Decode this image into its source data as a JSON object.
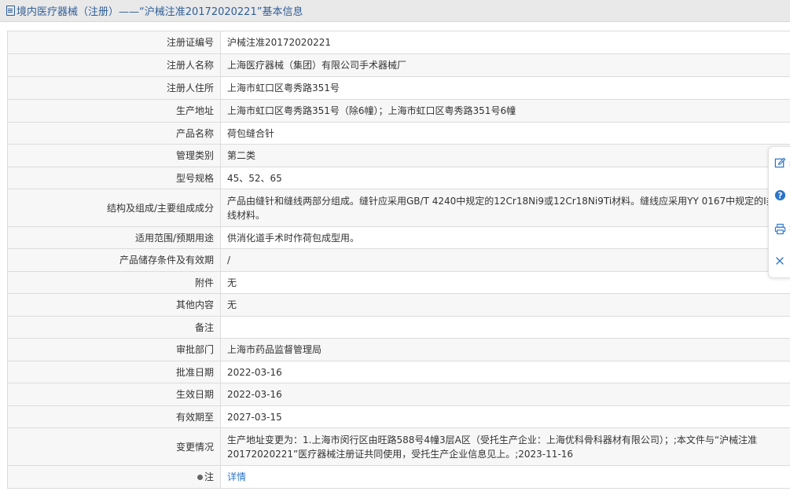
{
  "header": {
    "title": "境内医疗器械（注册）——“沪械注准20172020221”基本信息"
  },
  "rows": [
    {
      "label": "注册证编号",
      "value": "沪械注准20172020221"
    },
    {
      "label": "注册人名称",
      "value": "上海医疗器械（集团）有限公司手术器械厂"
    },
    {
      "label": "注册人住所",
      "value": "上海市虹口区粤秀路351号"
    },
    {
      "label": "生产地址",
      "value": "上海市虹口区粤秀路351号（除6幢）；上海市虹口区粤秀路351号6幢"
    },
    {
      "label": "产品名称",
      "value": "荷包缝合针"
    },
    {
      "label": "管理类别",
      "value": "第二类"
    },
    {
      "label": "型号规格",
      "value": "45、52、65"
    },
    {
      "label": "结构及组成/主要组成成分",
      "value": "产品由缝针和缝线两部分组成。缝针应采用GB/T 4240中规定的12Cr18Ni9或12Cr18Ni9Ti材料。缝线应采用YY 0167中规定的I类缝线材料。"
    },
    {
      "label": "适用范围/预期用途",
      "value": "供消化道手术时作荷包成型用。"
    },
    {
      "label": "产品储存条件及有效期",
      "value": "/"
    },
    {
      "label": "附件",
      "value": "无"
    },
    {
      "label": "其他内容",
      "value": "无"
    },
    {
      "label": "备注",
      "value": ""
    },
    {
      "label": "审批部门",
      "value": "上海市药品监督管理局"
    },
    {
      "label": "批准日期",
      "value": "2022-03-16"
    },
    {
      "label": "生效日期",
      "value": "2022-03-16"
    },
    {
      "label": "有效期至",
      "value": "2027-03-15"
    },
    {
      "label": "变更情况",
      "value": "生产地址变更为：1.上海市闵行区由旺路588号4幢3层A区（受托生产企业：上海优科骨科器材有限公司）；;本文件与“沪械注准20172020221”医疗器械注册证共同使用，受托生产企业信息见上。;2023-11-16"
    }
  ],
  "note": {
    "label": "注",
    "link": "详情"
  },
  "sidebar": {
    "items": [
      {
        "icon": "edit-icon",
        "label": "纠"
      },
      {
        "icon": "help-icon",
        "label": "?"
      },
      {
        "icon": "print-icon",
        "label": "打"
      },
      {
        "icon": "close-icon",
        "label": "关"
      }
    ]
  },
  "colors": {
    "header_text": "#2e5e99",
    "link": "#2a74c9",
    "label_bg": "#f7f7f7",
    "border": "#dcdcdc"
  }
}
